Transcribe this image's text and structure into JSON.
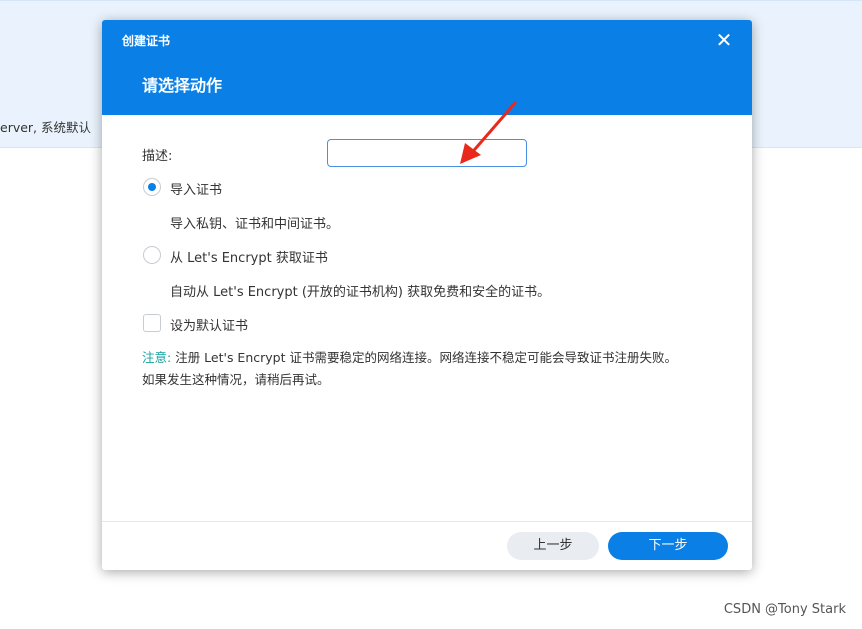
{
  "background": {
    "text": "erver, 系统默认",
    "watermark": "CSDN @Tony Stark"
  },
  "dialog": {
    "title": "创建证书",
    "close_icon": "close-icon",
    "subtitle": "请选择动作",
    "description": {
      "label": "描述:",
      "value": "",
      "placeholder": ""
    },
    "options": [
      {
        "label": "导入证书",
        "description": "导入私钥、证书和中间证书。",
        "selected": true
      },
      {
        "label": "从 Let's Encrypt 获取证书",
        "description": "自动从 Let's Encrypt (开放的证书机构) 获取免费和安全的证书。",
        "selected": false
      }
    ],
    "default_checkbox": {
      "label": "设为默认证书",
      "checked": false
    },
    "note": {
      "prefix": "注意:",
      "line1": " 注册 Let's Encrypt 证书需要稳定的网络连接。网络连接不稳定可能会导致证书注册失败。",
      "line2": "如果发生这种情况，请稍后再试。"
    },
    "buttons": {
      "prev": "上一步",
      "next": "下一步"
    },
    "colors": {
      "header": "#0a7fe5",
      "note_prefix": "#17a3a0",
      "annotation_arrow": "#e8291c"
    }
  }
}
